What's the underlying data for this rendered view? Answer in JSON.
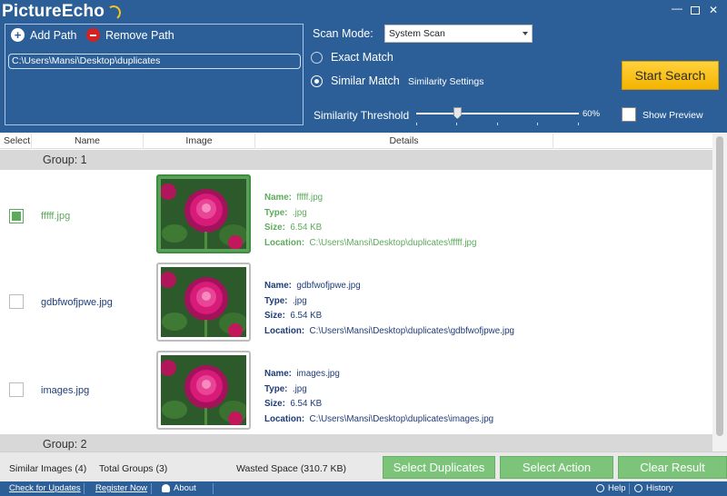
{
  "app": {
    "logo": "PictureEcho"
  },
  "window_controls": {
    "minimize": "—",
    "close": "✕"
  },
  "toolbar": {
    "add_path": "Add Path",
    "remove_path": "Remove Path"
  },
  "paths": [
    "C:\\Users\\Mansi\\Desktop\\duplicates"
  ],
  "scan": {
    "mode_label": "Scan Mode:",
    "mode_value": "System Scan",
    "exact_match": "Exact Match",
    "similar_match": "Similar Match",
    "selected_match": "Similar Match",
    "similarity_settings": "Similarity Settings",
    "threshold_label": "Similarity Threshold",
    "threshold_value": "60%",
    "threshold_percent": 25
  },
  "start_search": "Start Search",
  "show_preview": {
    "label": "Show Preview",
    "checked": false
  },
  "columns": {
    "select": "Select",
    "name": "Name",
    "image": "Image",
    "details": "Details"
  },
  "detail_labels": {
    "name": "Name:",
    "type": "Type:",
    "size": "Size:",
    "location": "Location:"
  },
  "groups": [
    {
      "title": "Group: 1",
      "items": [
        {
          "filename": "fffff.jpg",
          "checked": true,
          "name": "fffff.jpg",
          "type": ".jpg",
          "size": "6.54 KB",
          "location": "C:\\Users\\Mansi\\Desktop\\duplicates\\fffff.jpg"
        },
        {
          "filename": "gdbfwofjpwe.jpg",
          "checked": false,
          "name": "gdbfwofjpwe.jpg",
          "type": ".jpg",
          "size": "6.54 KB",
          "location": "C:\\Users\\Mansi\\Desktop\\duplicates\\gdbfwofjpwe.jpg"
        },
        {
          "filename": "images.jpg",
          "checked": false,
          "name": "images.jpg",
          "type": ".jpg",
          "size": "6.54 KB",
          "location": "C:\\Users\\Mansi\\Desktop\\duplicates\\images.jpg"
        }
      ]
    },
    {
      "title": "Group: 2",
      "items": []
    }
  ],
  "summary": {
    "similar_images": "Similar Images (4)",
    "total_groups": "Total Groups (3)",
    "wasted_space": "Wasted Space (310.7 KB)"
  },
  "actions": {
    "select_duplicates": "Select Duplicates",
    "select_action": "Select Action",
    "clear_result": "Clear Result"
  },
  "statusbar": {
    "check_updates": "Check for Updates",
    "register_now": "Register Now",
    "about": "About",
    "help": "Help",
    "history": "History"
  },
  "colors": {
    "header_blue": "#2c5f98",
    "accent_yellow": "#f4b400",
    "selected_green": "#5daa5d",
    "button_green": "#7cc47a"
  }
}
